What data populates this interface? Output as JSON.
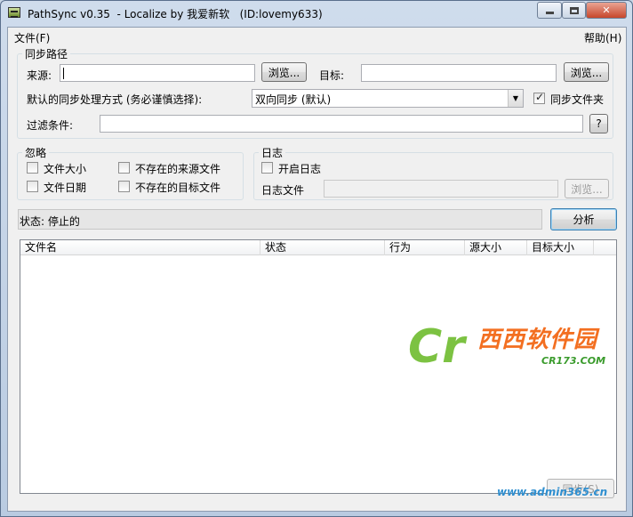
{
  "window": {
    "title": "PathSync v0.35  - Localize by 我爱新软   (ID:lovemy633)"
  },
  "menu": {
    "file": "文件(F)",
    "help": "帮助(H)"
  },
  "paths_group": {
    "legend": "同步路径",
    "source_label": "来源:",
    "source_value": "",
    "browse_source": "浏览...",
    "target_label": "目标:",
    "target_value": "",
    "browse_target": "浏览...",
    "mode_label": "默认的同步处理方式 (务必谨慎选择):",
    "mode_value": "双向同步 (默认)",
    "sync_folders_label": "同步文件夹",
    "sync_folders_checked": true,
    "filter_label": "过滤条件:",
    "filter_value": "",
    "help_button": "?"
  },
  "ignore_group": {
    "legend": "忽略",
    "items": [
      {
        "label": "文件大小",
        "checked": false
      },
      {
        "label": "文件日期",
        "checked": false
      },
      {
        "label": "不存在的来源文件",
        "checked": false
      },
      {
        "label": "不存在的目标文件",
        "checked": false
      }
    ]
  },
  "log_group": {
    "legend": "日志",
    "enable_label": "开启日志",
    "enable_checked": false,
    "file_label": "日志文件",
    "file_value": "",
    "browse": "浏览..."
  },
  "status": {
    "text": "状态: 停止的"
  },
  "analyze_button": "分析",
  "file_list": {
    "columns": [
      "文件名",
      "状态",
      "行为",
      "源大小",
      "目标大小"
    ],
    "rows": []
  },
  "sync_button": "同步(S)",
  "watermarks": {
    "brand": "西西软件园",
    "brand_logo": "Cr",
    "brand_sub": "CR173.COM",
    "site": "www.admin365.cn"
  }
}
